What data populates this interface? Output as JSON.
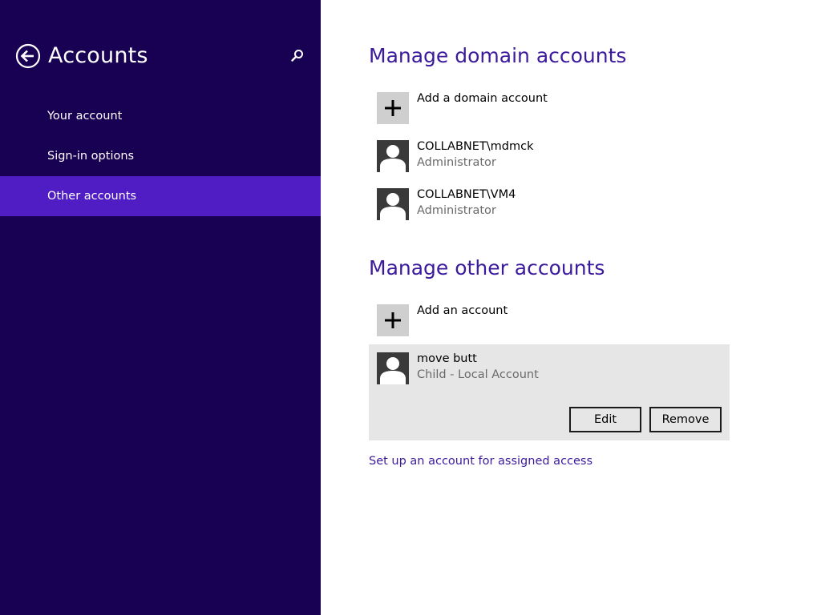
{
  "sidebar": {
    "title": "Accounts",
    "back_icon": "arrow-left-circle-icon",
    "search_icon": "search-icon",
    "items": [
      {
        "label": "Your account",
        "selected": false
      },
      {
        "label": "Sign-in options",
        "selected": false
      },
      {
        "label": "Other accounts",
        "selected": true
      }
    ],
    "colors": {
      "background": "#180052",
      "selected": "#4f1dc3"
    }
  },
  "main": {
    "domain_section": {
      "title": "Manage domain accounts",
      "add_label": "Add a domain account",
      "accounts": [
        {
          "name": "COLLABNET\\mdmck",
          "role": "Administrator"
        },
        {
          "name": "COLLABNET\\VM4",
          "role": "Administrator"
        }
      ]
    },
    "other_section": {
      "title": "Manage other accounts",
      "add_label": "Add an account",
      "accounts": [
        {
          "name": "move butt",
          "role": "Child - Local Account",
          "selected": true
        }
      ],
      "edit_label": "Edit",
      "remove_label": "Remove"
    },
    "assigned_access_link": "Set up an account for assigned access",
    "colors": {
      "heading": "#3c1a9c",
      "link": "#3c1a9c"
    }
  }
}
